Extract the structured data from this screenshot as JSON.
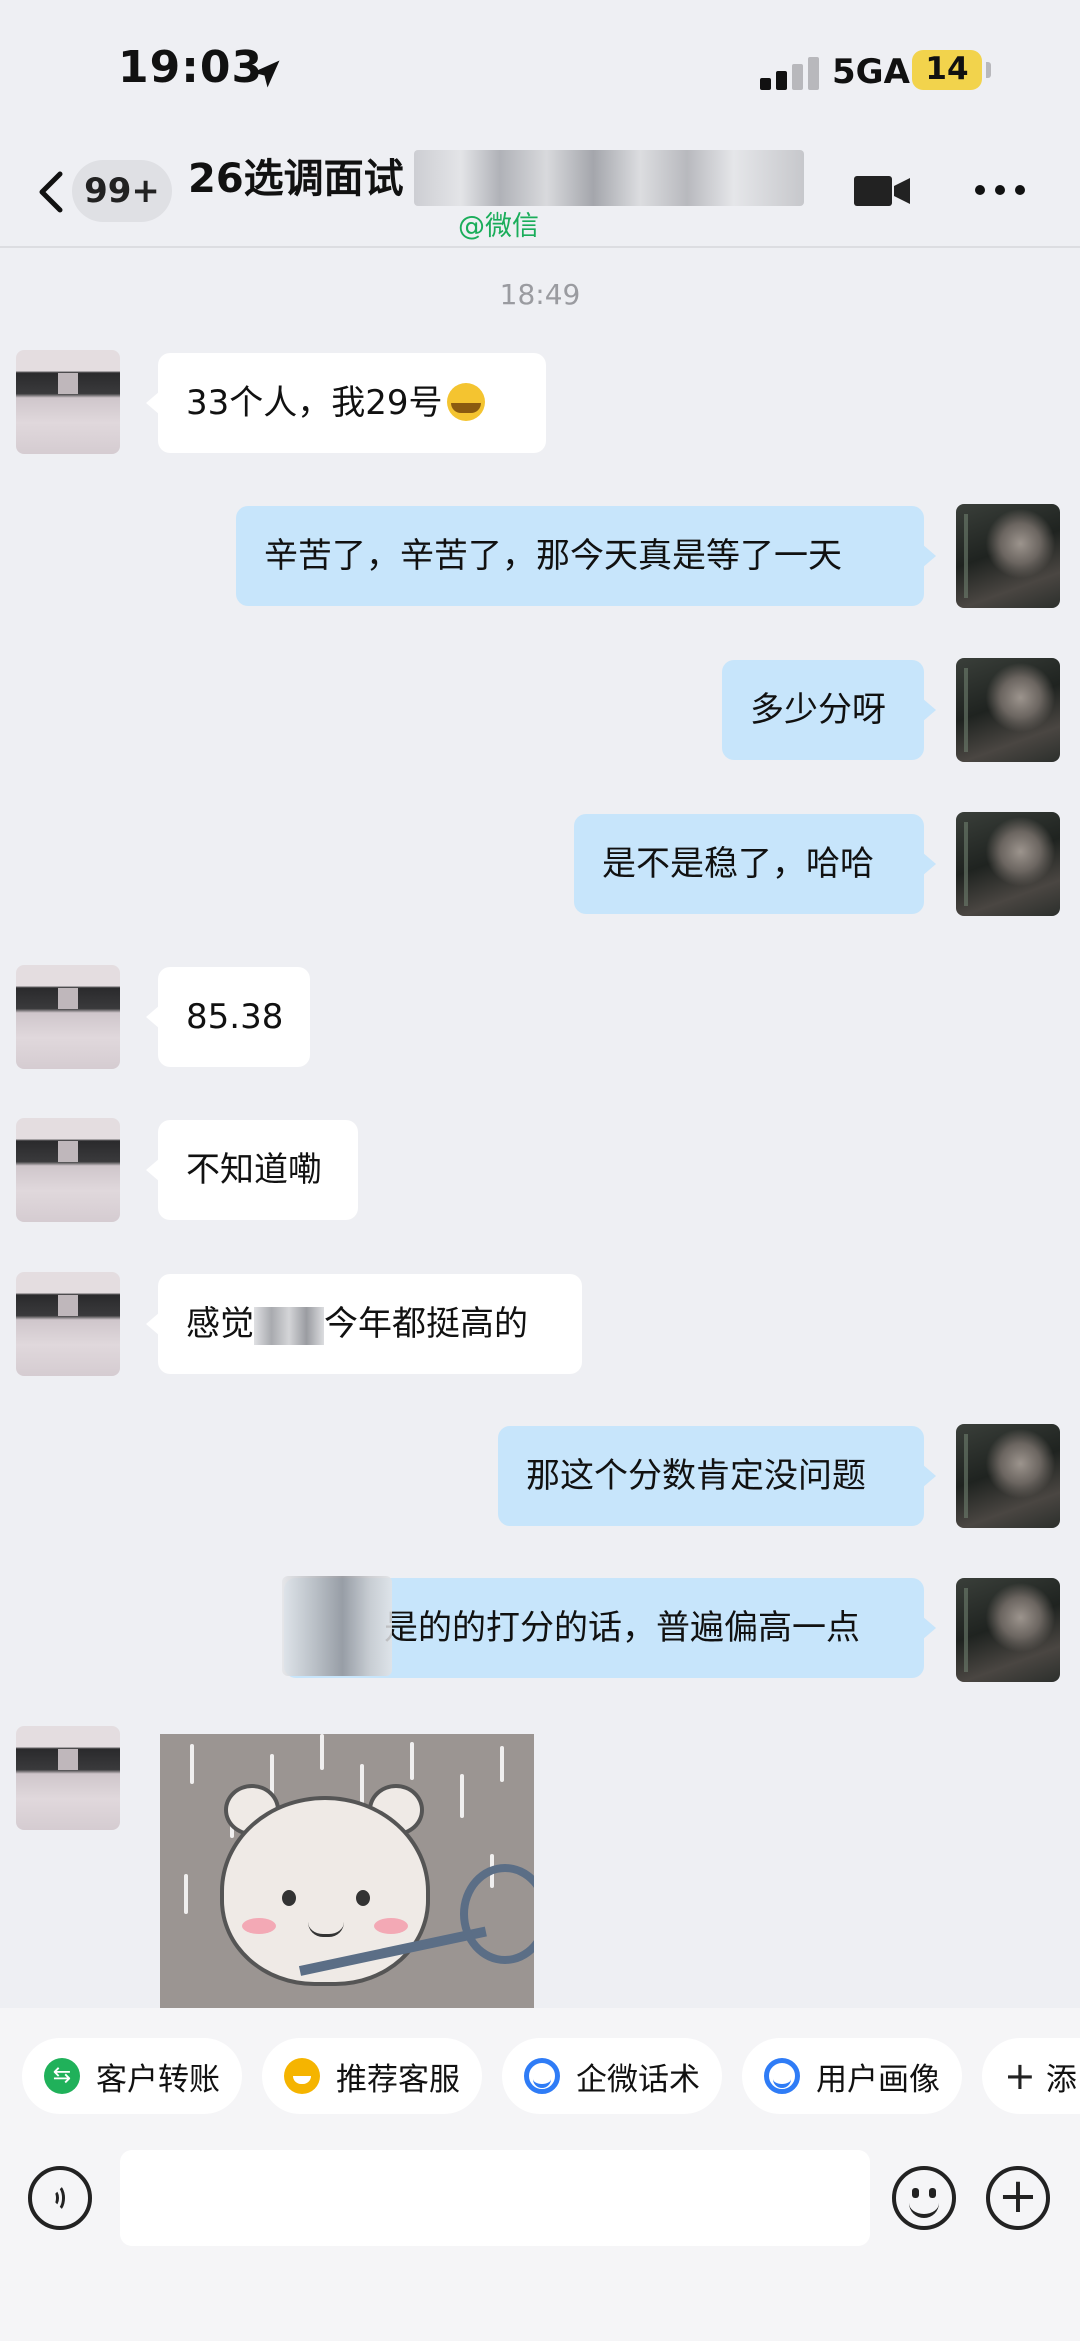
{
  "status_bar": {
    "time": "19:03",
    "network": "5GA",
    "battery": "14"
  },
  "header": {
    "unread_badge": "99+",
    "title": "26选调面试",
    "source_tag": "@微信"
  },
  "messages": {
    "timestamp": "18:49",
    "items": [
      {
        "side": "in",
        "text": "33个人，我29号"
      },
      {
        "side": "out",
        "text": "辛苦了，辛苦了，那今天真是等了一天"
      },
      {
        "side": "out",
        "text": "多少分呀"
      },
      {
        "side": "out",
        "text": "是不是稳了，哈哈"
      },
      {
        "side": "in",
        "text": "85.38"
      },
      {
        "side": "in",
        "text": "不知道嘞"
      },
      {
        "side": "in",
        "text_before": "感觉",
        "text_after": "今年都挺高的"
      },
      {
        "side": "out",
        "text": "那这个分数肯定没问题"
      },
      {
        "side": "out",
        "text": "是的的打分的话，普遍偏高一点"
      }
    ]
  },
  "quick_actions": [
    {
      "label": "客户转账",
      "icon": "transfer-icon"
    },
    {
      "label": "推荐客服",
      "icon": "service-icon"
    },
    {
      "label": "企微话术",
      "icon": "script-icon"
    },
    {
      "label": "用户画像",
      "icon": "profile-icon"
    },
    {
      "label": "添",
      "icon": "plus-icon"
    }
  ],
  "input": {
    "placeholder": ""
  },
  "colors": {
    "incoming_bubble": "#ffffff",
    "outgoing_bubble": "#c7e5fb",
    "wechat_green": "#1aad5a",
    "background": "#eeeff3"
  }
}
